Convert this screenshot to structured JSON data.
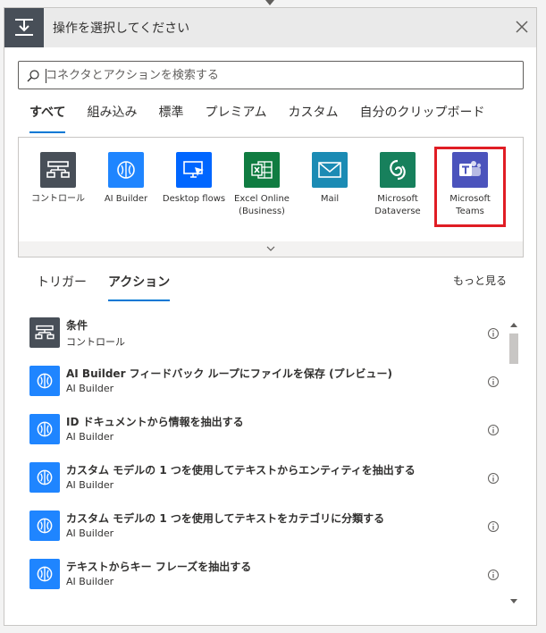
{
  "header": {
    "title": "操作を選択してください"
  },
  "search": {
    "placeholder": "コネクタとアクションを検索する"
  },
  "tabs": [
    "すべて",
    "組み込み",
    "標準",
    "プレミアム",
    "カスタム",
    "自分のクリップボード"
  ],
  "connectors": [
    {
      "label": "コントロール",
      "icon": "control-icon",
      "color": "#484f58"
    },
    {
      "label": "AI Builder",
      "icon": "ai-builder-icon",
      "color": "#1f85ff"
    },
    {
      "label": "Desktop flows",
      "icon": "desktop-flows-icon",
      "color": "#0066ff"
    },
    {
      "label": "Excel Online (Business)",
      "icon": "excel-icon",
      "color": "#107c41"
    },
    {
      "label": "Mail",
      "icon": "mail-icon",
      "color": "#1b8bb4"
    },
    {
      "label": "Microsoft Dataverse",
      "icon": "dataverse-icon",
      "color": "#17805c"
    },
    {
      "label": "Microsoft Teams",
      "icon": "teams-icon",
      "color": "#4b53bc",
      "selected": true
    }
  ],
  "subtabs": [
    "トリガー",
    "アクション"
  ],
  "more_link": "もっと見る",
  "actions": [
    {
      "title": "条件",
      "subtitle": "コントロール",
      "icon": "control-icon",
      "color": "#484f58"
    },
    {
      "title": "AI Builder フィードバック ループにファイルを保存 (プレビュー)",
      "subtitle": "AI Builder",
      "icon": "ai-builder-icon",
      "color": "#1f85ff"
    },
    {
      "title": "ID ドキュメントから情報を抽出する",
      "subtitle": "AI Builder",
      "icon": "ai-builder-icon",
      "color": "#1f85ff"
    },
    {
      "title": "カスタム モデルの 1 つを使用してテキストからエンティティを抽出する",
      "subtitle": "AI Builder",
      "icon": "ai-builder-icon",
      "color": "#1f85ff"
    },
    {
      "title": "カスタム モデルの 1 つを使用してテキストをカテゴリに分類する",
      "subtitle": "AI Builder",
      "icon": "ai-builder-icon",
      "color": "#1f85ff"
    },
    {
      "title": "テキストからキー フレーズを抽出する",
      "subtitle": "AI Builder",
      "icon": "ai-builder-icon",
      "color": "#1f85ff"
    }
  ]
}
